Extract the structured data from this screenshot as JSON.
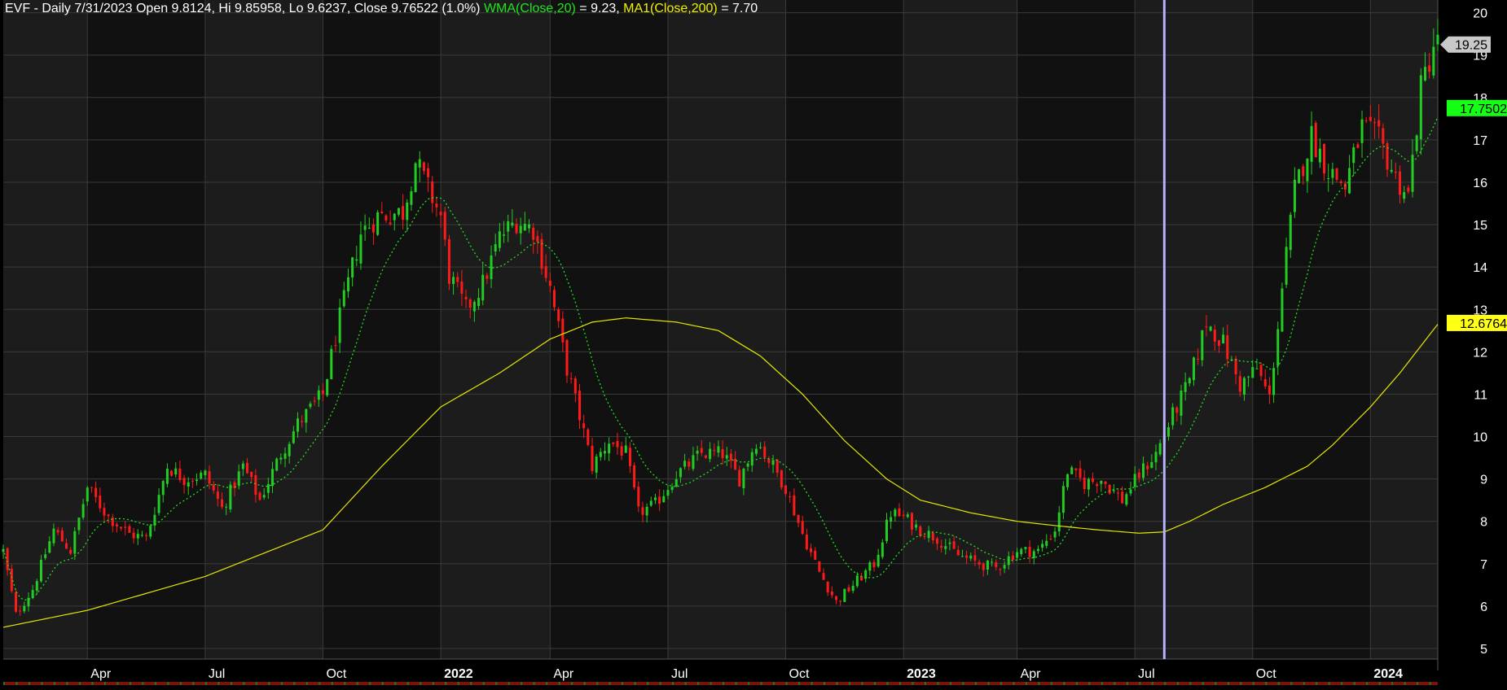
{
  "header": {
    "prefix": "EVF - Daily 7/31/2023 Open 9.8124, Hi 9.85958, Lo 9.6237, Close 9.76522 (1.0%)",
    "wma_label": "WMA(Close,20)",
    "wma_value": " = 9.23,",
    "ma_label": "MA1(Close,200)",
    "ma_value": " = 7.70"
  },
  "colors": {
    "background": "#000000",
    "band_light": "#1c1c1c",
    "band_dark": "#111111",
    "grid": "#3a3a3a",
    "up_candle": "#22cc22",
    "down_candle": "#ff1a1a",
    "wma_line": "#22dd22",
    "ma_line": "#e6e600",
    "cursor": "#b4b4ff",
    "axis_text": "#ffffff"
  },
  "chart_data": {
    "type": "candlestick",
    "ylim": [
      4.75,
      20.3
    ],
    "yticks": [
      5,
      6,
      7,
      8,
      9,
      10,
      11,
      12,
      13,
      14,
      15,
      16,
      17,
      18,
      19,
      20
    ],
    "x_labels": [
      {
        "label": "Apr",
        "t": 20,
        "bold": false
      },
      {
        "label": "Jul",
        "t": 48,
        "bold": false
      },
      {
        "label": "Oct",
        "t": 76,
        "bold": false
      },
      {
        "label": "2022",
        "t": 104,
        "bold": true
      },
      {
        "label": "Apr",
        "t": 130,
        "bold": false
      },
      {
        "label": "Jul",
        "t": 158,
        "bold": false
      },
      {
        "label": "Oct",
        "t": 186,
        "bold": false
      },
      {
        "label": "2023",
        "t": 214,
        "bold": true
      },
      {
        "label": "Apr",
        "t": 241,
        "bold": false
      },
      {
        "label": "Jul",
        "t": 269,
        "bold": false
      },
      {
        "label": "Oct",
        "t": 297,
        "bold": false
      },
      {
        "label": "2024",
        "t": 325,
        "bold": true
      }
    ],
    "t_max": 341,
    "cursor_t": 276,
    "price_path": [
      [
        0,
        7.3
      ],
      [
        3,
        5.8
      ],
      [
        7,
        6.4
      ],
      [
        12,
        7.8
      ],
      [
        16,
        7.3
      ],
      [
        20,
        8.8
      ],
      [
        25,
        8.1
      ],
      [
        30,
        7.7
      ],
      [
        34,
        7.6
      ],
      [
        39,
        9.3
      ],
      [
        43,
        9.0
      ],
      [
        48,
        9.1
      ],
      [
        52,
        8.3
      ],
      [
        57,
        9.3
      ],
      [
        61,
        8.5
      ],
      [
        66,
        9.6
      ],
      [
        70,
        10.3
      ],
      [
        76,
        11.0
      ],
      [
        80,
        12.8
      ],
      [
        85,
        14.8
      ],
      [
        89,
        15.2
      ],
      [
        95,
        15.3
      ],
      [
        98,
        16.5
      ],
      [
        104,
        15.2
      ],
      [
        106,
        13.8
      ],
      [
        110,
        13.0
      ],
      [
        114,
        13.6
      ],
      [
        118,
        14.7
      ],
      [
        122,
        15.1
      ],
      [
        126,
        14.9
      ],
      [
        130,
        13.5
      ],
      [
        134,
        11.6
      ],
      [
        138,
        10.1
      ],
      [
        140,
        9.3
      ],
      [
        144,
        9.9
      ],
      [
        148,
        9.6
      ],
      [
        151,
        8.2
      ],
      [
        155,
        8.4
      ],
      [
        160,
        9.1
      ],
      [
        166,
        9.6
      ],
      [
        171,
        9.6
      ],
      [
        175,
        9.0
      ],
      [
        179,
        9.9
      ],
      [
        183,
        9.3
      ],
      [
        186,
        8.8
      ],
      [
        190,
        7.7
      ],
      [
        194,
        6.8
      ],
      [
        198,
        6.1
      ],
      [
        202,
        6.5
      ],
      [
        207,
        7.0
      ],
      [
        211,
        8.2
      ],
      [
        214,
        8.1
      ],
      [
        218,
        7.8
      ],
      [
        222,
        7.6
      ],
      [
        227,
        7.2
      ],
      [
        232,
        7.0
      ],
      [
        236,
        6.9
      ],
      [
        241,
        7.3
      ],
      [
        246,
        7.3
      ],
      [
        250,
        7.8
      ],
      [
        253,
        9.2
      ],
      [
        257,
        8.9
      ],
      [
        261,
        9.0
      ],
      [
        266,
        8.5
      ],
      [
        270,
        9.1
      ],
      [
        274,
        9.6
      ],
      [
        278,
        10.5
      ],
      [
        282,
        11.3
      ],
      [
        286,
        12.7
      ],
      [
        290,
        12.2
      ],
      [
        294,
        11.2
      ],
      [
        298,
        11.6
      ],
      [
        301,
        10.9
      ],
      [
        304,
        13.5
      ],
      [
        307,
        15.8
      ],
      [
        311,
        17.1
      ],
      [
        315,
        16.3
      ],
      [
        319,
        15.9
      ],
      [
        323,
        17.3
      ],
      [
        327,
        17.0
      ],
      [
        331,
        16.1
      ],
      [
        334,
        15.7
      ],
      [
        337,
        18.2
      ],
      [
        340,
        19.25
      ]
    ],
    "ma_path": [
      [
        0,
        5.5
      ],
      [
        20,
        5.9
      ],
      [
        48,
        6.7
      ],
      [
        76,
        7.8
      ],
      [
        90,
        9.3
      ],
      [
        104,
        10.7
      ],
      [
        118,
        11.5
      ],
      [
        130,
        12.3
      ],
      [
        140,
        12.7
      ],
      [
        148,
        12.8
      ],
      [
        160,
        12.7
      ],
      [
        170,
        12.5
      ],
      [
        180,
        11.9
      ],
      [
        190,
        11.0
      ],
      [
        200,
        9.9
      ],
      [
        210,
        9.0
      ],
      [
        218,
        8.5
      ],
      [
        230,
        8.2
      ],
      [
        241,
        8.0
      ],
      [
        250,
        7.9
      ],
      [
        260,
        7.8
      ],
      [
        270,
        7.72
      ],
      [
        276,
        7.75
      ],
      [
        282,
        8.0
      ],
      [
        290,
        8.4
      ],
      [
        300,
        8.8
      ],
      [
        310,
        9.3
      ],
      [
        316,
        9.8
      ],
      [
        325,
        10.7
      ],
      [
        332,
        11.5
      ],
      [
        341,
        12.65
      ]
    ],
    "price_labels": [
      {
        "label": "19.25",
        "value": 19.25,
        "style": "arrow"
      },
      {
        "label": "17.7502",
        "value": 17.75,
        "style": "green"
      },
      {
        "label": "12.6764",
        "value": 12.68,
        "style": "yellow"
      }
    ]
  }
}
